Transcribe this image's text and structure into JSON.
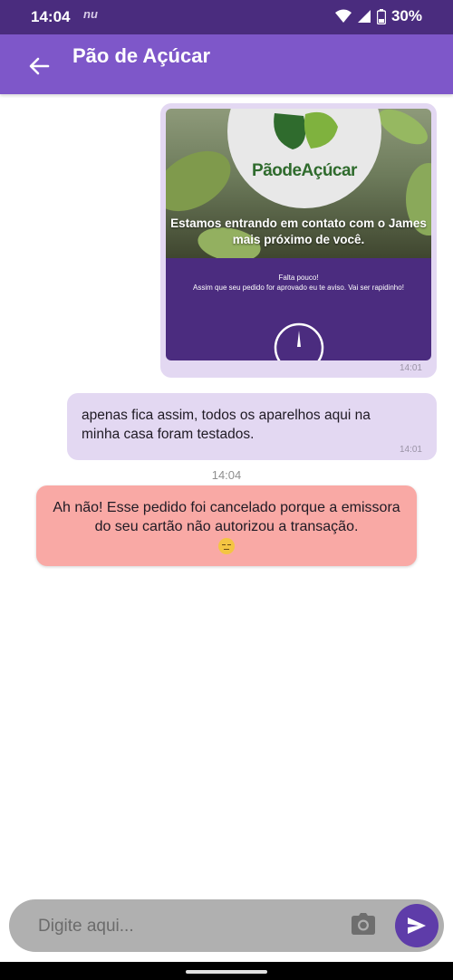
{
  "status_bar": {
    "time": "14:04",
    "app_badge": "nu",
    "battery": "30%"
  },
  "app_bar": {
    "title": "Pão de Açúcar"
  },
  "messages": {
    "image_message": {
      "logo": "PãodeAçúcar",
      "caption": "Estamos entrando em contato com o James mais próximo de você.",
      "small_title": "Falta pouco!",
      "small_text": "Assim que seu pedido for aprovado eu te aviso. Vai ser rapidinho!",
      "time": "14:01"
    },
    "text_message": {
      "text": "apenas fica assim, todos os aparelhos aqui na minha casa foram testados.",
      "time": "14:01"
    },
    "divider_time": "14:04",
    "alert_message": {
      "text": "Ah não! Esse pedido foi cancelado porque a emissora do seu cartão não autorizou a transação."
    }
  },
  "input": {
    "placeholder": "Digite aqui..."
  },
  "colors": {
    "status_bar": "#4a2c7e",
    "app_bar": "#7e57c9",
    "bubble": "#e3d8f2",
    "alert_bubble": "#f9a9a5",
    "send_button": "#5e3ca9"
  },
  "icons": [
    "back-arrow-icon",
    "wifi-icon",
    "signal-icon",
    "battery-icon",
    "camera-icon",
    "send-icon",
    "sad-emoji-icon"
  ]
}
